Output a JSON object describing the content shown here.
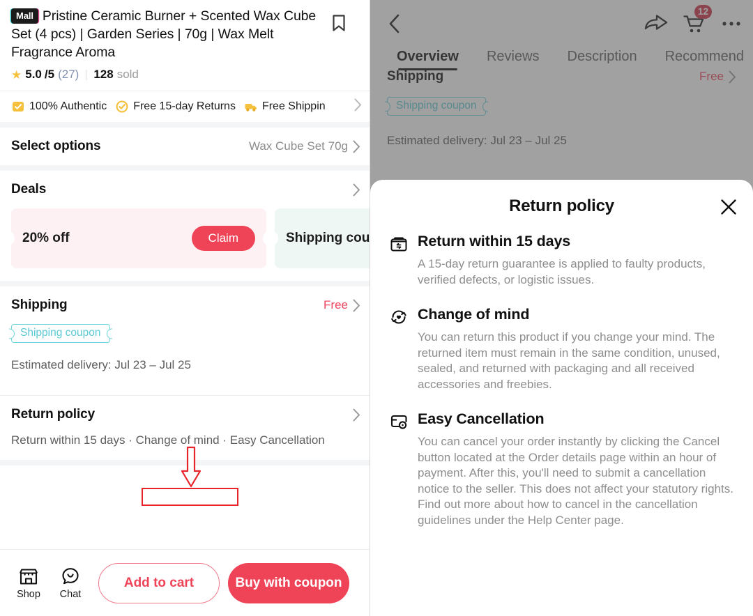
{
  "product": {
    "badge": "Mall",
    "title": "Pristine Ceramic Burner + Scented Wax Cube Set (4 pcs) | Garden Series | 70g | Wax Melt Fragrance Aroma",
    "rating_value": "5.0",
    "rating_denom": "/5",
    "rating_count": "(27)",
    "sold_count": "128",
    "sold_label": "sold",
    "bookmark_icon": "bookmark-icon"
  },
  "trust": {
    "items": [
      {
        "label": "100% Authentic",
        "icon": "authentic-badge-icon"
      },
      {
        "label": "Free 15-day Returns",
        "icon": "returns-check-icon"
      },
      {
        "label": "Free Shippin",
        "icon": "truck-icon"
      }
    ],
    "chevron_icon": "chevron-right-icon"
  },
  "options": {
    "title": "Select options",
    "value": "Wax Cube Set 70g",
    "chevron_icon": "chevron-right-icon"
  },
  "deals": {
    "title": "Deals",
    "chevron_icon": "chevron-right-icon",
    "coupons": [
      {
        "label": "20% off",
        "action": "Claim",
        "style": "pink"
      },
      {
        "label": "Shipping coup",
        "action": "",
        "style": "mint"
      }
    ]
  },
  "shipping": {
    "title": "Shipping",
    "value": "Free",
    "coupon_chip": "Shipping coupon",
    "estimated_delivery": "Estimated delivery: Jul 23 – Jul 25",
    "chevron_icon": "chevron-right-icon"
  },
  "return_policy_row": {
    "title": "Return policy",
    "summary_parts": [
      "Return within 15 days",
      "Change of mind",
      "Easy Cancellation"
    ],
    "summary_sep": " · ",
    "chevron_icon": "chevron-right-icon"
  },
  "annotation": {
    "color": "#e8232a",
    "highlighted_text": "Change of mind",
    "arrow_icon": "down-arrow-annotation"
  },
  "bottom_bar": {
    "shop_label": "Shop",
    "shop_icon": "storefront-icon",
    "chat_label": "Chat",
    "chat_icon": "chat-bubble-icon",
    "add_to_cart": "Add to cart",
    "buy_with_coupon": "Buy with coupon"
  },
  "right_pane": {
    "back_icon": "chevron-left-icon",
    "share_icon": "share-arrow-icon",
    "cart_icon": "shopping-cart-icon",
    "cart_badge": "12",
    "more_icon": "more-horizontal-icon",
    "tabs": [
      {
        "label": "Overview",
        "active": true
      },
      {
        "label": "Reviews",
        "active": false
      },
      {
        "label": "Description",
        "active": false
      },
      {
        "label": "Recommend",
        "active": false
      }
    ],
    "shipping_title": "Shipping",
    "shipping_value": "Free",
    "coupon_chip": "Shipping coupon",
    "estimated_delivery": "Estimated delivery: Jul 23 – Jul 25"
  },
  "modal": {
    "title": "Return policy",
    "close_icon": "close-x-icon",
    "sections": [
      {
        "icon": "return-box-icon",
        "heading": "Return within 15 days",
        "body": "A 15-day return guarantee is applied to faulty products, verified defects, or logistic issues."
      },
      {
        "icon": "refresh-heart-icon",
        "heading": "Change of mind",
        "body": "You can return this product if you change your mind. The returned item must remain in the same condition, unused, sealed, and returned with packaging and all received accessories and freebies."
      },
      {
        "icon": "cancel-card-icon",
        "heading": "Easy Cancellation",
        "body": "You can cancel your order instantly by clicking the Cancel button located at the Order details page within an hour of payment. After this, you'll need to submit a cancellation notice to the seller. This does not affect your statutory rights. Find out more about how to cancel in the cancellation guidelines under the Help Center page."
      }
    ]
  },
  "colors": {
    "accent_red": "#ef4358",
    "teal": "#6fd4dd",
    "gold": "#f5c13c",
    "annotation_red": "#e8232a"
  }
}
